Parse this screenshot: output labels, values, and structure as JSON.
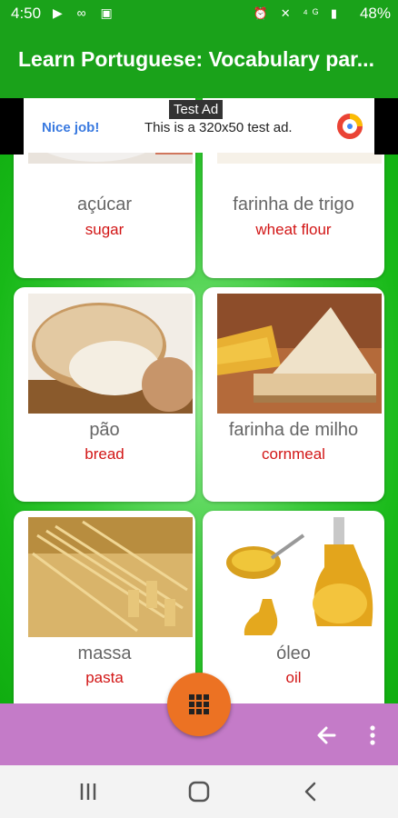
{
  "status_bar": {
    "time": "4:50",
    "battery": "48%"
  },
  "app_bar": {
    "title": "Learn Portuguese: Vocabulary par..."
  },
  "ad": {
    "label": "Test Ad",
    "cta": "Nice job!",
    "text": "This is a 320x50 test ad."
  },
  "cards": [
    {
      "portuguese": "açúcar",
      "english": "sugar",
      "image": "sugar-image"
    },
    {
      "portuguese": "farinha de trigo",
      "english": "wheat flour",
      "image": "wheat-image"
    },
    {
      "portuguese": "pão",
      "english": "bread",
      "image": "bread-image"
    },
    {
      "portuguese": "farinha de milho",
      "english": "cornmeal",
      "image": "cornmeal-image"
    },
    {
      "portuguese": "massa",
      "english": "pasta",
      "image": "pasta-image"
    },
    {
      "portuguese": "óleo",
      "english": "oil",
      "image": "oil-image"
    }
  ],
  "colors": {
    "app_bar": "#1aa21a",
    "bottom_bar": "#c47bc8",
    "fab": "#ec7223",
    "english_text": "#d21616"
  }
}
